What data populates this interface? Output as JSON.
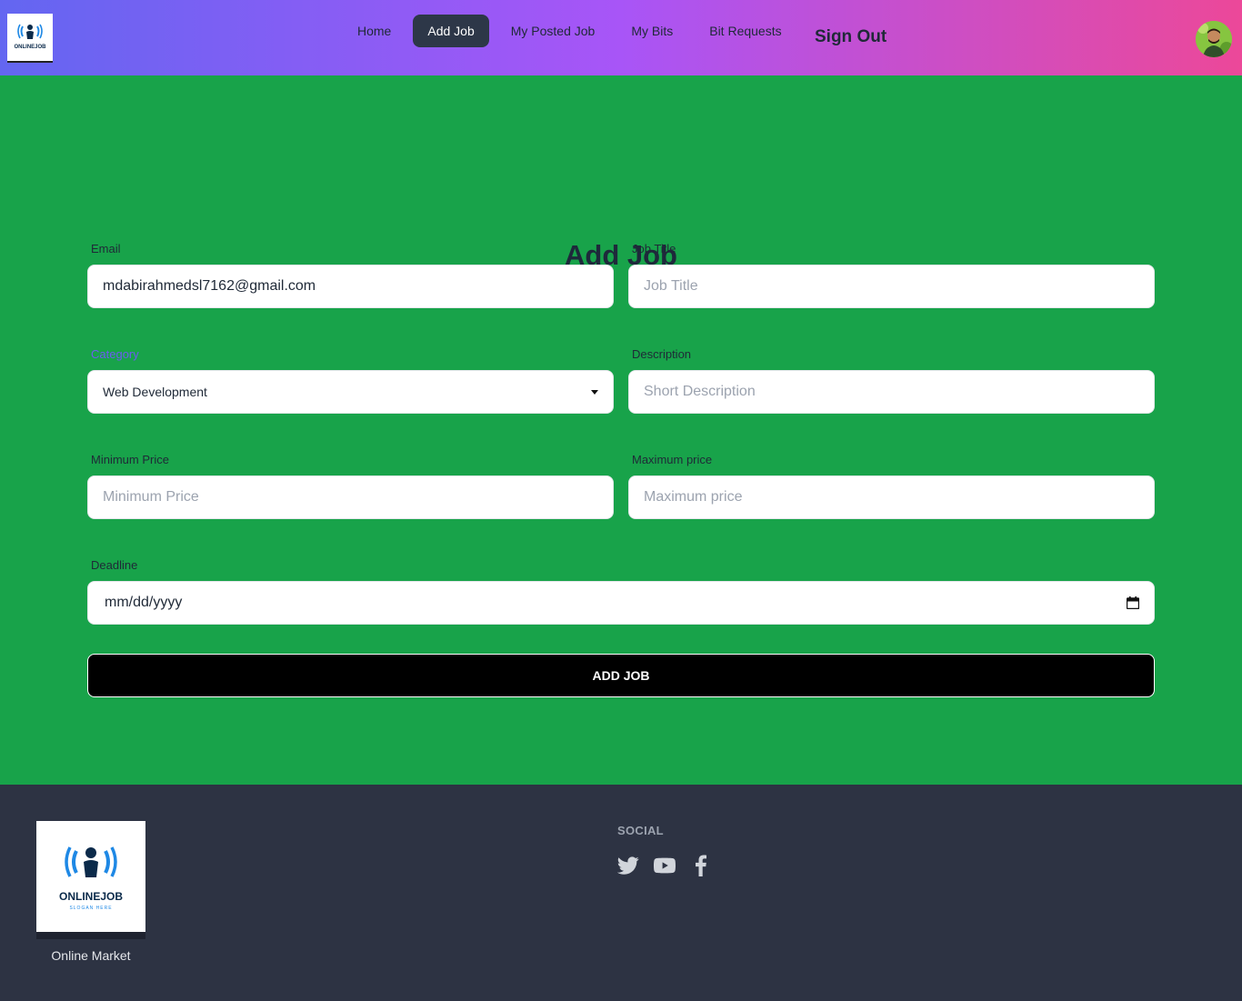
{
  "nav": {
    "items": [
      {
        "label": "Home",
        "active": false
      },
      {
        "label": "Add Job",
        "active": true
      },
      {
        "label": "My Posted Job",
        "active": false
      },
      {
        "label": "My Bits",
        "active": false
      },
      {
        "label": "Bit Requests",
        "active": false
      }
    ],
    "signout_label": "Sign Out",
    "logo_text": "ONLINEJOB"
  },
  "form": {
    "title": "Add Job",
    "email": {
      "label": "Email",
      "value": "mdabirahmedsl7162@gmail.com"
    },
    "job_title": {
      "label": "Job Title",
      "placeholder": "Job Title"
    },
    "category": {
      "label": "Category",
      "value": "Web Development"
    },
    "description": {
      "label": "Description",
      "placeholder": "Short Description"
    },
    "min_price": {
      "label": "Minimum Price",
      "placeholder": "Minimum Price"
    },
    "max_price": {
      "label": "Maximum price",
      "placeholder": "Maximum price"
    },
    "deadline": {
      "label": "Deadline",
      "placeholder": "mm/dd/yyyy"
    },
    "submit_label": "ADD JOB"
  },
  "footer": {
    "logo_text": "ONLINEJOB",
    "logo_slogan": "SLOGAN HERE",
    "brand": "Online Market",
    "social_title": "SOCIAL",
    "social_icons": [
      "twitter-icon",
      "youtube-icon",
      "facebook-icon"
    ]
  },
  "colors": {
    "nav_gradient_start": "#6366f1",
    "nav_gradient_mid": "#a855f7",
    "nav_gradient_end": "#ec4899",
    "main_bg": "#18a34a",
    "footer_bg": "#2d3343",
    "active_nav": "#2d3748",
    "button_bg": "#000000"
  }
}
